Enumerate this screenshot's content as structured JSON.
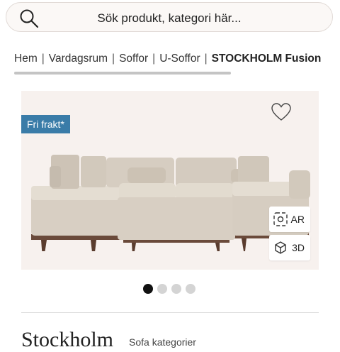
{
  "search": {
    "placeholder": "Sök produkt, kategori här..."
  },
  "breadcrumb": [
    {
      "label": "Hem"
    },
    {
      "label": "Vardagsrum"
    },
    {
      "label": "Soffor"
    },
    {
      "label": "U-Soffor"
    },
    {
      "label": "STOCKHOLM Fusion"
    }
  ],
  "gallery": {
    "badge": "Fri frakt*",
    "ar_label": "AR",
    "view3d_label": "3D",
    "slide_count": 4,
    "active_slide": 1
  },
  "product": {
    "title": "Stockholm",
    "subtitle": "Sofa kategorier"
  },
  "icons": {
    "search": "search-icon",
    "favorite": "heart-icon",
    "ar": "ar-icon",
    "view3d": "cube-3d-icon"
  },
  "colors": {
    "badge": "#3a7ca8",
    "gallery_bg": "#f7f1ee",
    "dot_active": "#111111",
    "dot_inactive": "#d4d4d4"
  }
}
